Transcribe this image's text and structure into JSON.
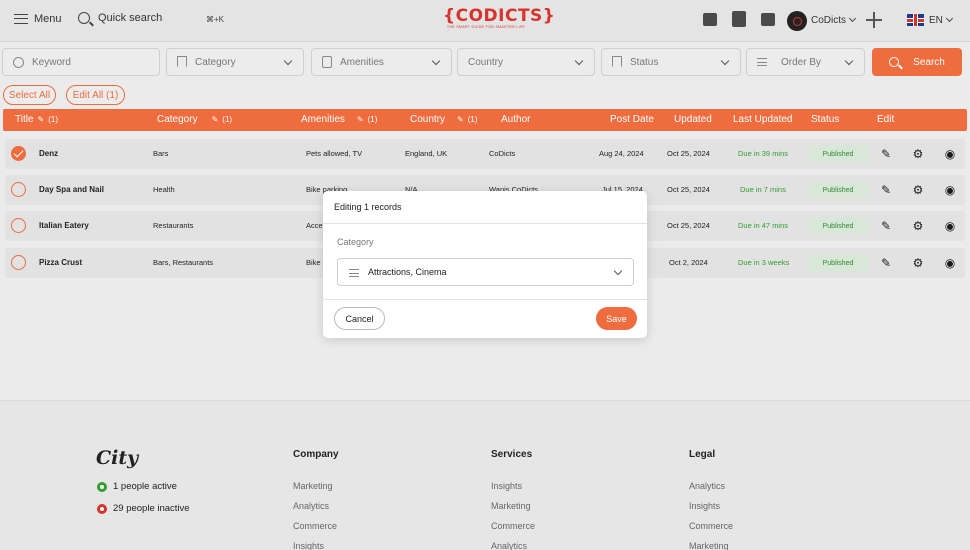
{
  "header": {
    "menu_label": "Menu",
    "search_label": "Quick search",
    "shortcut": "⌘+K",
    "logo_text": "{CODICTS}",
    "logo_subtext": "THE SMART GUIDE FOR SMARTER LIFE",
    "user_name": "CoDicts",
    "language": "EN"
  },
  "filters": {
    "keyword": "Keyword",
    "category": "Category",
    "amenities": "Amenities",
    "country": "Country",
    "status": "Status",
    "order_by": "Order By",
    "search_button": "Search"
  },
  "actions": {
    "select_all": "Select All",
    "edit_all": "Edit All (1)"
  },
  "table": {
    "headers": {
      "title": "Title",
      "title_count": "(1)",
      "category": "Category",
      "category_count": "(1)",
      "amenities": "Amenities",
      "amenities_count": "(1)",
      "country": "Country",
      "country_count": "(1)",
      "author": "Author",
      "post_date": "Post Date",
      "updated": "Updated",
      "last_updated": "Last Updated",
      "status": "Status",
      "edit": "Edit"
    },
    "rows": [
      {
        "title": "Denz",
        "category": "Bars",
        "amenities": "Pets allowed, TV",
        "country": "England, UK",
        "author": "CoDicts",
        "post_date": "Aug 24, 2024",
        "updated": "Oct 25, 2024",
        "last_updated": "Due in 39 mins",
        "status": "Published",
        "checked": true
      },
      {
        "title": "Day Spa and Nail",
        "category": "Health",
        "amenities": "Bike parking",
        "country": "N/A",
        "author": "Wanis CoDicts",
        "post_date": "Jul 15, 2024",
        "updated": "Oct 25, 2024",
        "last_updated": "Due in 7 mins",
        "status": "Published",
        "checked": false
      },
      {
        "title": "Italian Eatery",
        "category": "Restaurants",
        "amenities": "Accessible, Pets allowed",
        "country": "",
        "author": "",
        "post_date": "",
        "updated": "Oct 25, 2024",
        "last_updated": "Due in 47 mins",
        "status": "Published",
        "checked": false
      },
      {
        "title": "Pizza Crust",
        "category": "Bars, Restaurants",
        "amenities": "Bike parking",
        "country": "",
        "author": "",
        "post_date": "",
        "updated": "Oct 2, 2024",
        "last_updated": "Due in 3 weeks",
        "status": "Published",
        "checked": false
      }
    ]
  },
  "modal": {
    "title": "Editing 1 records",
    "field_label": "Category",
    "field_value": "Attractions, Cinema",
    "cancel": "Cancel",
    "save": "Save"
  },
  "footer": {
    "logo": "City",
    "active": "1 people active",
    "inactive": "29 people inactive",
    "columns": [
      {
        "heading": "Company",
        "items": [
          "Marketing",
          "Analytics",
          "Commerce",
          "Insights"
        ]
      },
      {
        "heading": "Services",
        "items": [
          "Insights",
          "Marketing",
          "Commerce",
          "Analytics"
        ]
      },
      {
        "heading": "Legal",
        "items": [
          "Analytics",
          "Insights",
          "Commerce",
          "Marketing"
        ]
      }
    ]
  },
  "colors": {
    "accent": "#ef6c3f",
    "brand": "#d7342b",
    "success": "#2f9e2f",
    "danger": "#d7342b"
  }
}
